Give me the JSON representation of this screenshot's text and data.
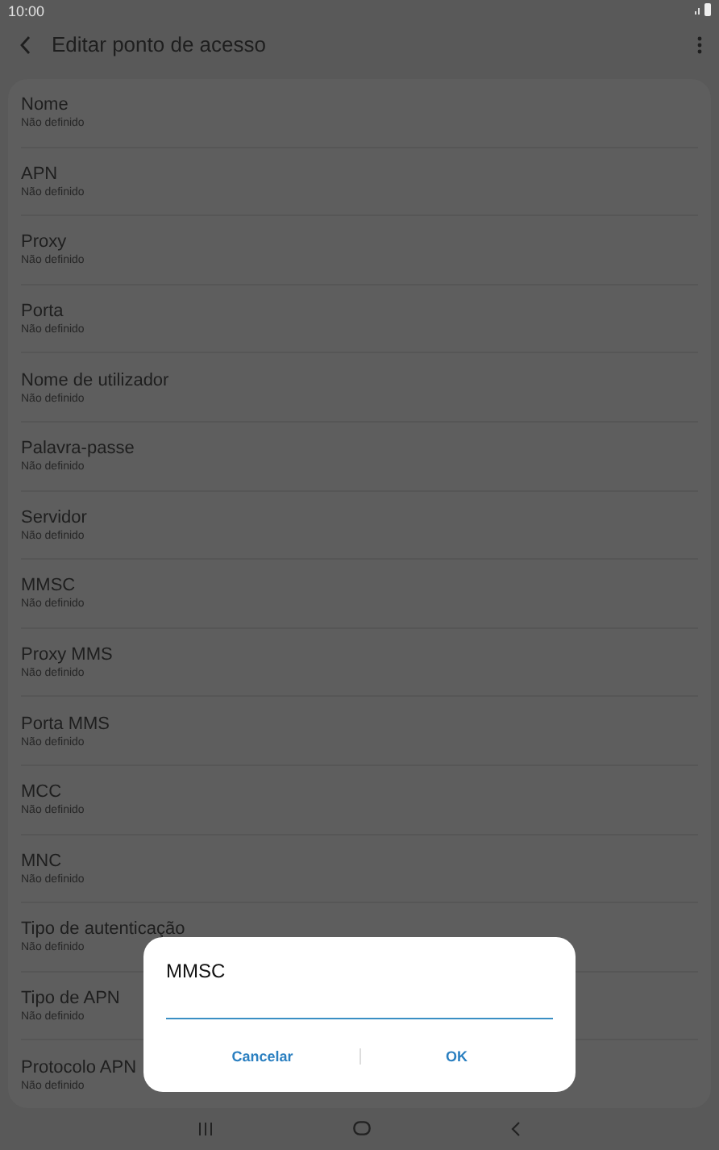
{
  "status_bar": {
    "time": "10:00"
  },
  "header": {
    "title": "Editar ponto de acesso"
  },
  "settings": [
    {
      "label": "Nome",
      "value": "Não definido"
    },
    {
      "label": "APN",
      "value": "Não definido"
    },
    {
      "label": "Proxy",
      "value": "Não definido"
    },
    {
      "label": "Porta",
      "value": "Não definido"
    },
    {
      "label": "Nome de utilizador",
      "value": "Não definido"
    },
    {
      "label": "Palavra-passe",
      "value": "Não definido"
    },
    {
      "label": "Servidor",
      "value": "Não definido"
    },
    {
      "label": "MMSC",
      "value": "Não definido"
    },
    {
      "label": "Proxy MMS",
      "value": "Não definido"
    },
    {
      "label": "Porta MMS",
      "value": "Não definido"
    },
    {
      "label": "MCC",
      "value": "Não definido"
    },
    {
      "label": "MNC",
      "value": "Não definido"
    },
    {
      "label": "Tipo de autenticação",
      "value": "Não definido"
    },
    {
      "label": "Tipo de APN",
      "value": "Não definido"
    },
    {
      "label": "Protocolo APN",
      "value": "Não definido"
    }
  ],
  "dialog": {
    "title": "MMSC",
    "buttons": [
      "Cancelar",
      "OK"
    ]
  }
}
